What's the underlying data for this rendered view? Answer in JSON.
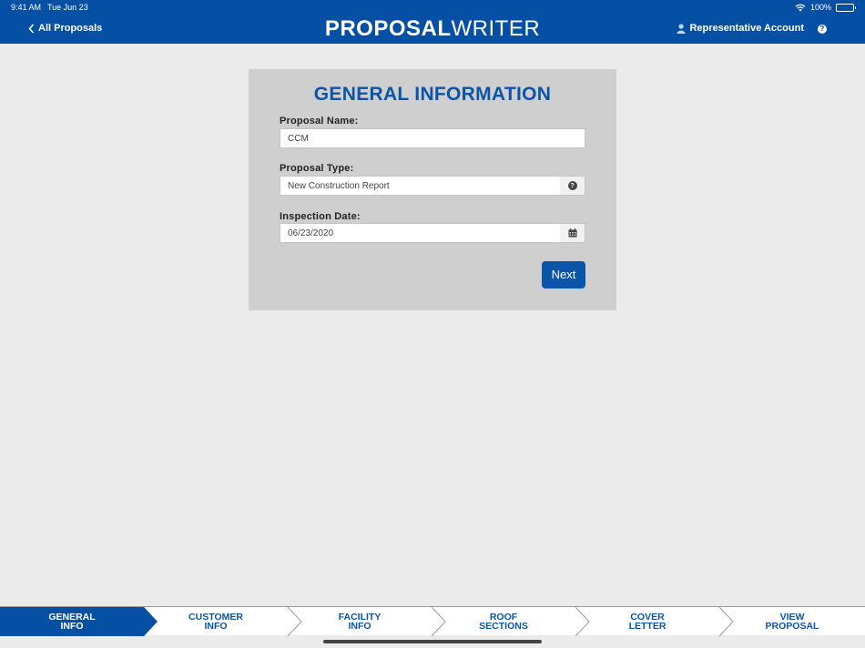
{
  "status": {
    "time": "9:41 AM",
    "date": "Tue Jun 23",
    "battery": "100%"
  },
  "header": {
    "back_label": "All Proposals",
    "brand_bold": "PROPOSAL",
    "brand_light": "WRITER",
    "account_label": "Representative Account"
  },
  "form": {
    "title": "GENERAL INFORMATION",
    "proposal_name_label": "Proposal Name:",
    "proposal_name_value": "CCM",
    "proposal_type_label": "Proposal Type:",
    "proposal_type_value": "New Construction Report",
    "inspection_date_label": "Inspection Date:",
    "inspection_date_value": "06/23/2020",
    "next_label": "Next"
  },
  "tabs": [
    {
      "line1": "GENERAL",
      "line2": "INFO"
    },
    {
      "line1": "CUSTOMER",
      "line2": "INFO"
    },
    {
      "line1": "FACILITY",
      "line2": "INFO"
    },
    {
      "line1": "ROOF",
      "line2": "SECTIONS"
    },
    {
      "line1": "COVER",
      "line2": "LETTER"
    },
    {
      "line1": "VIEW",
      "line2": "PROPOSAL"
    }
  ],
  "colors": {
    "brand_blue": "#0550a4",
    "background": "#ebebeb",
    "card": "#cfcfcf"
  }
}
